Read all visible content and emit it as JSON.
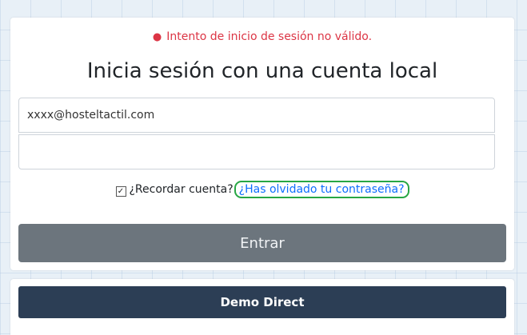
{
  "error": {
    "message": "Intento de inicio de sesión no válido."
  },
  "login": {
    "title": "Inicia sesión con una cuenta local",
    "email_value": "xxxx@hosteltactil.com",
    "password_value": "",
    "remember_label": "¿Recordar cuenta?",
    "remember_checked": true,
    "forgot_label": "¿Has olvidado tu contraseña?",
    "submit_label": "Entrar"
  },
  "demo": {
    "button_label": "Demo Direct"
  },
  "colors": {
    "error": "#dc3545",
    "link": "#0d6efd",
    "highlight": "#28a745",
    "submit_bg": "#6c757d",
    "demo_bg": "#2c3e55"
  }
}
